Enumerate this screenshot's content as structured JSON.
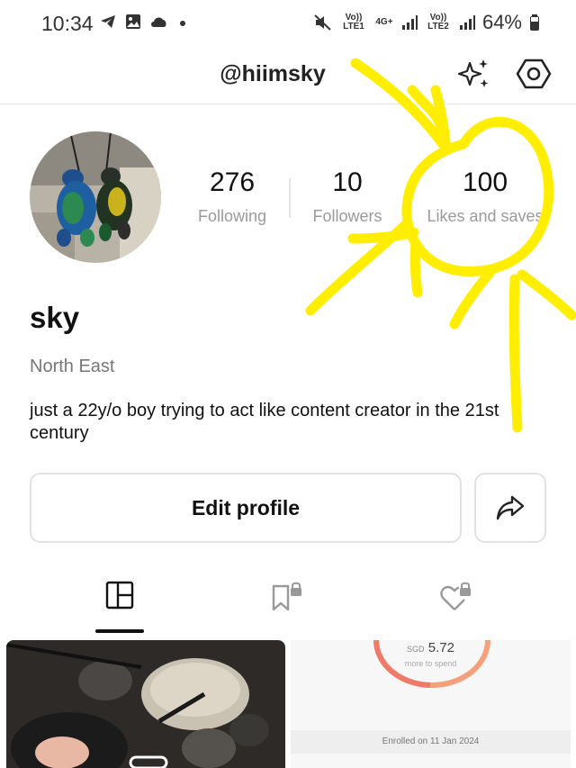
{
  "status_bar": {
    "time": "10:34",
    "net1": "Vo)) LTE1",
    "net_type": "4G+",
    "net2": "Vo)) LTE2",
    "battery": "64%",
    "icons": [
      "telegram-icon",
      "gallery-icon",
      "cloud-icon",
      "dot-icon",
      "mute-icon",
      "signal-icon",
      "battery-icon"
    ]
  },
  "header": {
    "username": "@hiimsky",
    "icons": [
      "sparkle-icon",
      "settings-icon"
    ]
  },
  "stats": {
    "following": {
      "value": "276",
      "label": "Following"
    },
    "followers": {
      "value": "10",
      "label": "Followers"
    },
    "likes": {
      "value": "100",
      "label": "Likes and saves"
    }
  },
  "profile": {
    "name": "sky",
    "location": "North East",
    "bio": "just a 22y/o boy trying to act like content creator in the 21st century"
  },
  "actions": {
    "edit_label": "Edit profile",
    "share_icon": "share-icon"
  },
  "tabs": [
    {
      "name": "posts",
      "icon": "grid-icon",
      "active": true
    },
    {
      "name": "saved",
      "icon": "bookmark-lock-icon",
      "active": false
    },
    {
      "name": "liked",
      "icon": "heart-lock-icon",
      "active": false
    }
  ],
  "posts": {
    "right_card": {
      "currency": "SGD",
      "amount": "5.72",
      "caption": "more to spend",
      "enrolled": "Enrolled on 11 Jan 2024"
    }
  },
  "annotation": {
    "color": "#ffee00"
  }
}
